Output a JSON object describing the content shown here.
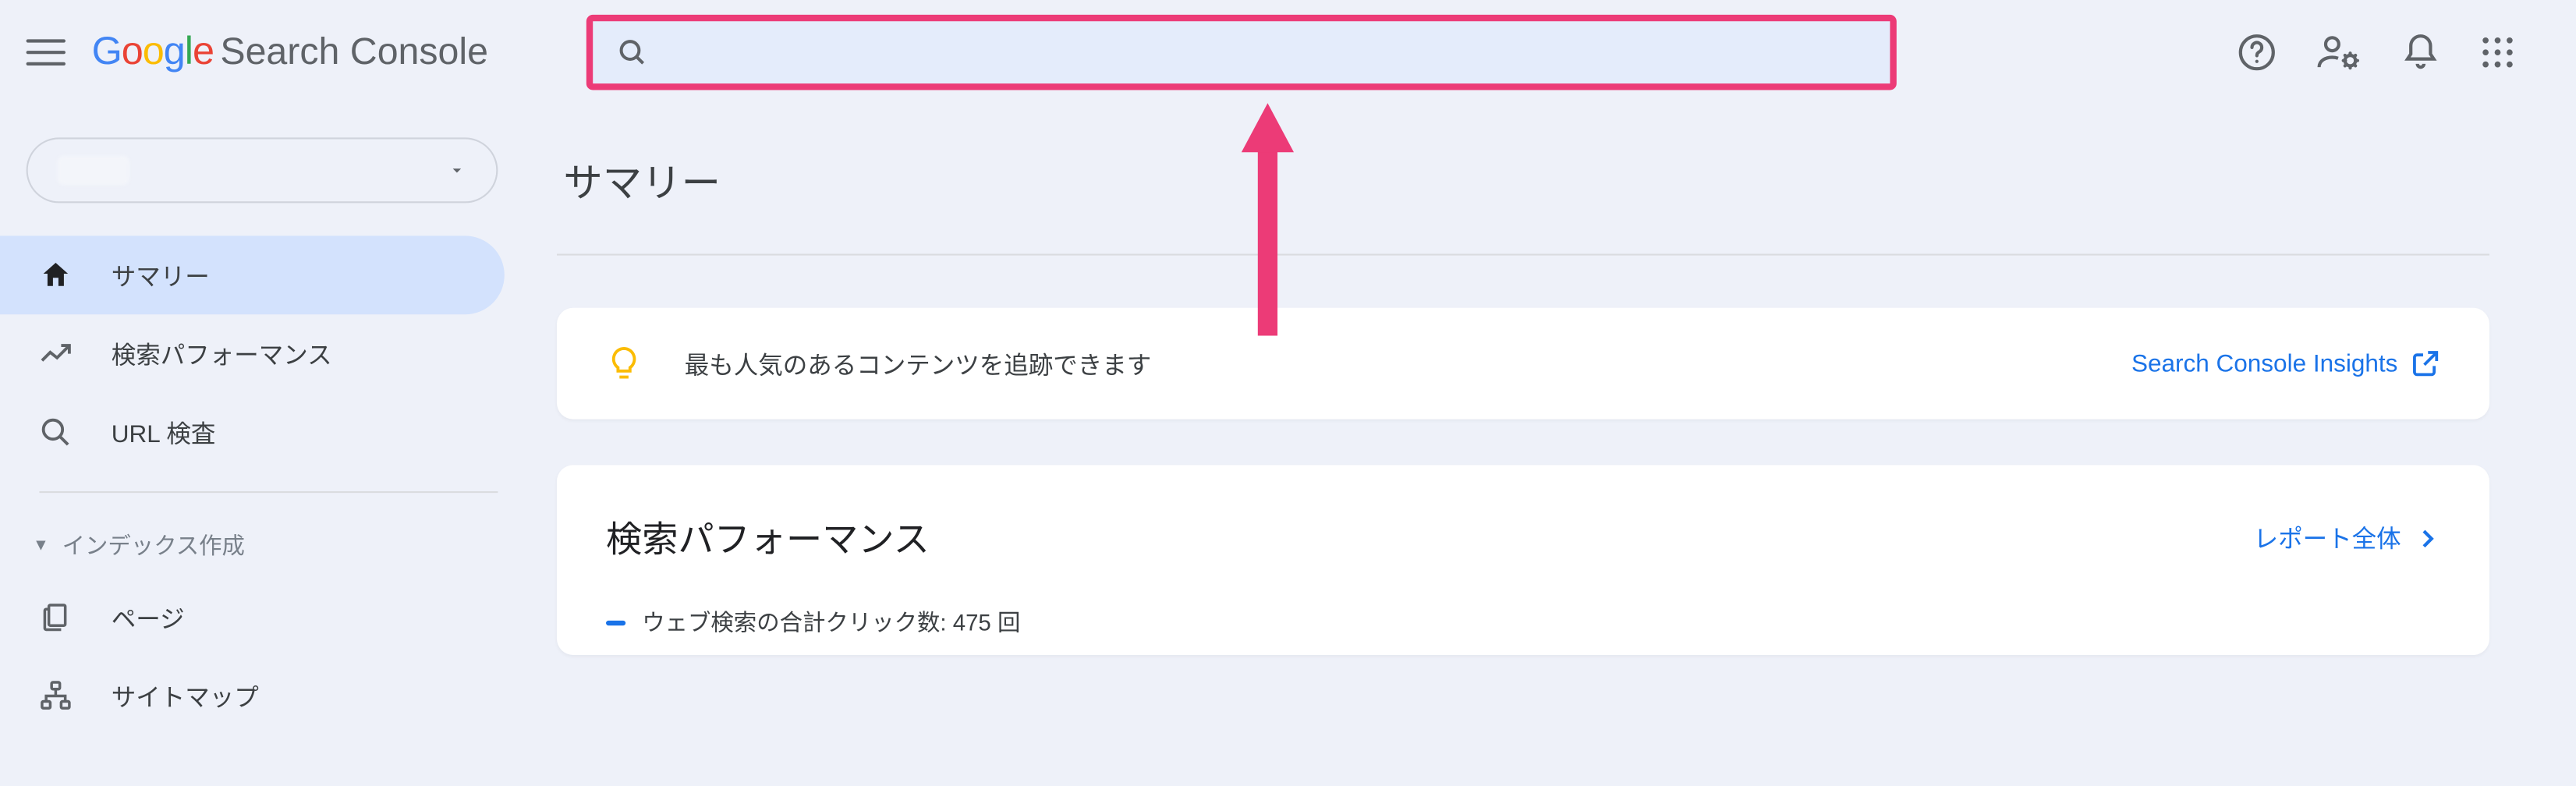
{
  "header": {
    "product_brand": "Google",
    "product_name": "Search Console"
  },
  "sidebar": {
    "items": {
      "summary": "サマリー",
      "performance": "検索パフォーマンス",
      "url_inspect": "URL 検査"
    },
    "section_indexing": "インデックス作成",
    "indexing_items": {
      "pages": "ページ",
      "sitemaps": "サイトマップ"
    }
  },
  "main": {
    "title": "サマリー",
    "banner_text": "最も人気のあるコンテンツを追跡できます",
    "banner_link": "Search Console Insights",
    "perf": {
      "heading": "検索パフォーマンス",
      "full_report": "レポート全体",
      "metric_label": "ウェブ検索の合計クリック数: 475 回"
    }
  }
}
